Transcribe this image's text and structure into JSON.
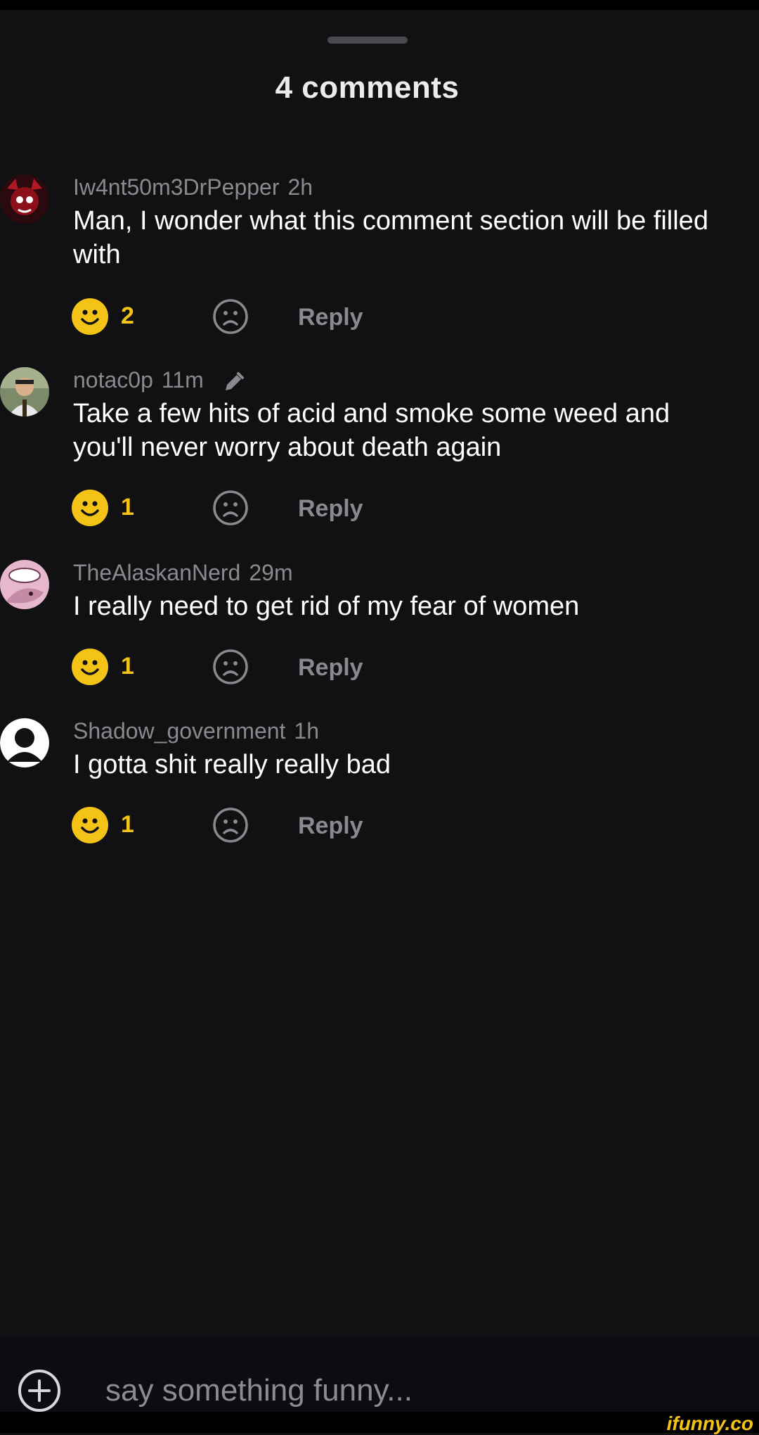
{
  "header": {
    "title": "4 comments"
  },
  "comments": [
    {
      "username": "Iw4nt50m3DrPepper",
      "time": "2h",
      "text": "Man, I wonder what this comment section will be filled with",
      "likes": "2",
      "reply_label": "Reply"
    },
    {
      "username": "notac0p",
      "time": "11m",
      "text": "Take a few hits of acid and smoke some weed and you'll never worry about death again",
      "likes": "1",
      "reply_label": "Reply"
    },
    {
      "username": "TheAlaskanNerd",
      "time": "29m",
      "text": "I really need to get rid of my fear of women",
      "likes": "1",
      "reply_label": "Reply"
    },
    {
      "username": "Shadow_government",
      "time": "1h",
      "text": "I gotta shit really really bad",
      "likes": "1",
      "reply_label": "Reply"
    }
  ],
  "composer": {
    "placeholder": "say something funny..."
  },
  "watermark": "ifunny.co",
  "colors": {
    "accent": "#f3c317",
    "background": "#111113",
    "muted": "#8a8a8e"
  }
}
